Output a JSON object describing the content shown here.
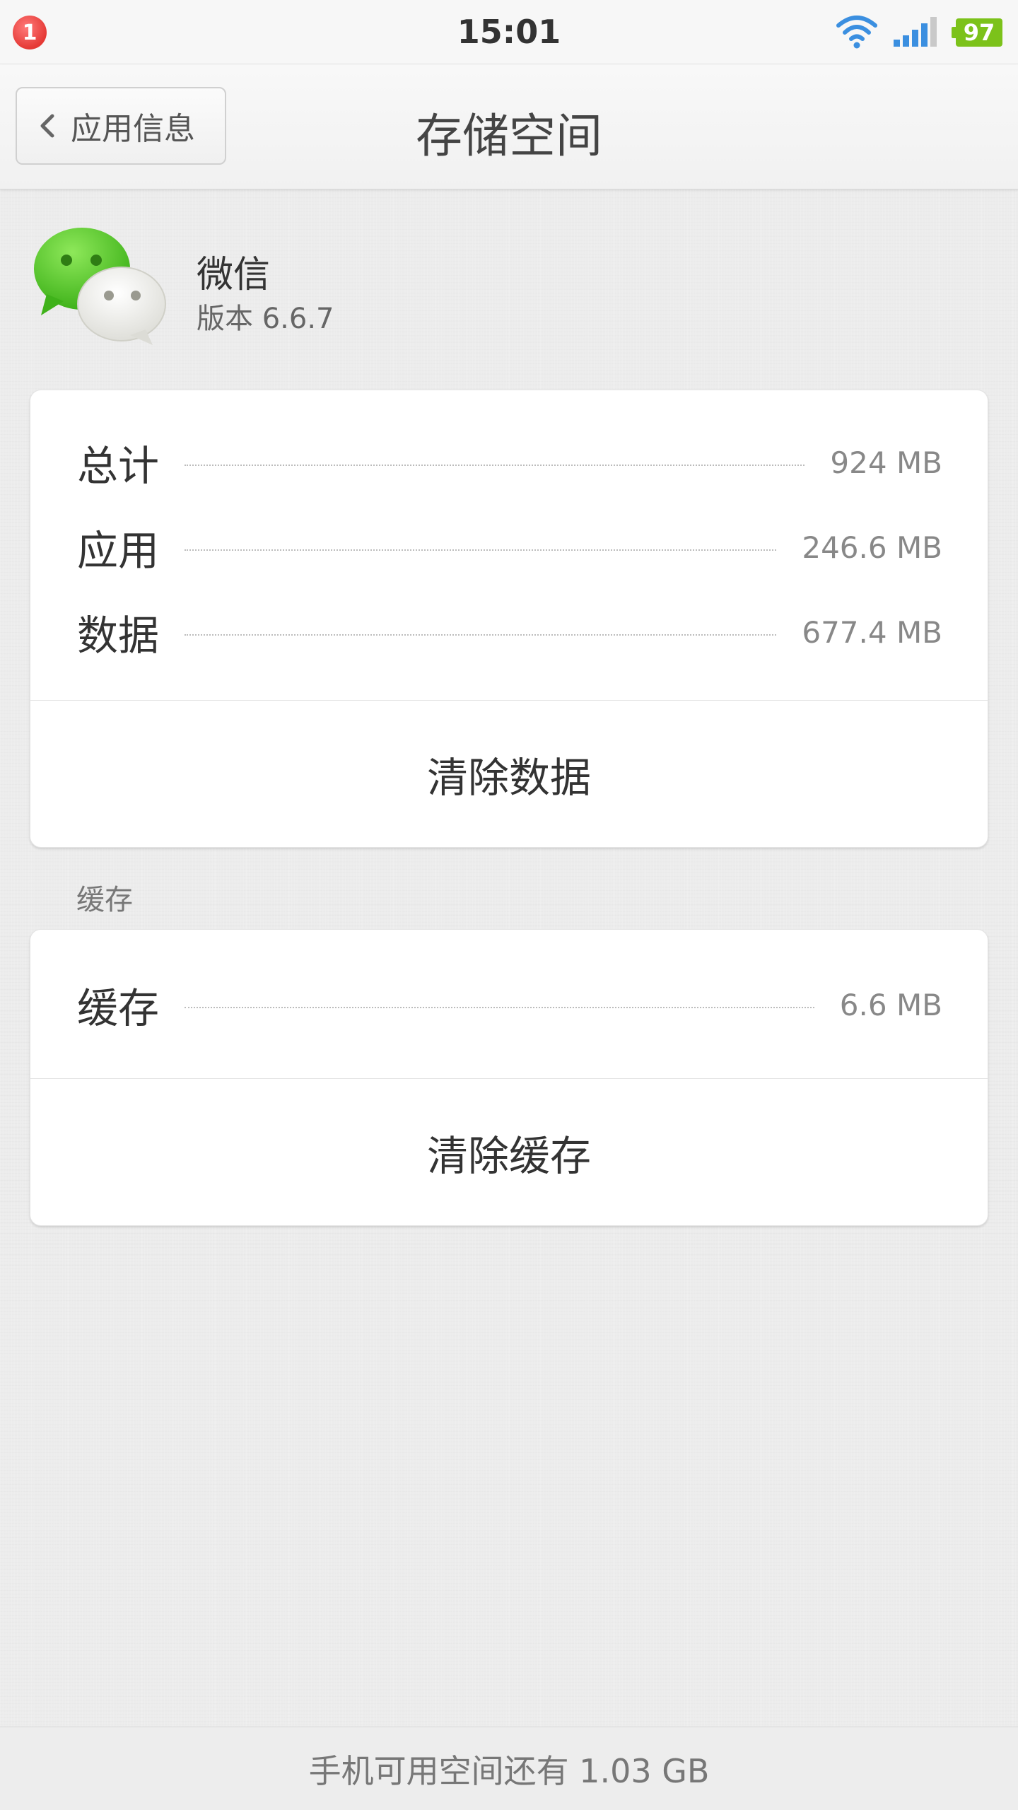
{
  "status_bar": {
    "notification_count": "1",
    "time": "15:01",
    "battery": "97",
    "icons": [
      "notification-badge",
      "wifi-icon",
      "signal-icon",
      "battery-icon"
    ]
  },
  "header": {
    "back_label": "应用信息",
    "title": "存储空间"
  },
  "app": {
    "name": "微信",
    "version": "版本 6.6.7",
    "icon": "wechat-icon"
  },
  "storage": {
    "rows": [
      {
        "label": "总计",
        "value": "924 MB"
      },
      {
        "label": "应用",
        "value": "246.6 MB"
      },
      {
        "label": "数据",
        "value": "677.4 MB"
      }
    ],
    "clear_button": "清除数据"
  },
  "cache": {
    "section_label": "缓存",
    "row": {
      "label": "缓存",
      "value": "6.6 MB"
    },
    "clear_button": "清除缓存"
  },
  "footer": {
    "text": "手机可用空间还有 1.03 GB"
  },
  "colors": {
    "background": "#ececec",
    "card": "#ffffff",
    "battery": "#7cc21a",
    "badge": "#e53935",
    "wifi_signal": "#3b8fe0",
    "wechat_green": "#5fcc29"
  }
}
